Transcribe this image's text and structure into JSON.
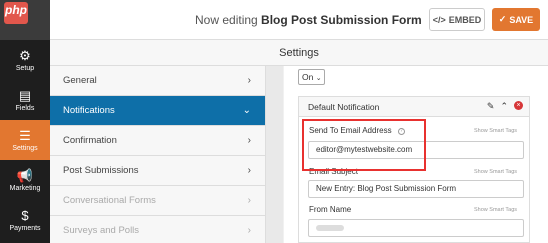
{
  "logo": {
    "text": "php"
  },
  "header": {
    "title_prefix": "Now editing",
    "form_name": "Blog Post Submission Form",
    "embed_label": "EMBED",
    "embed_icon": "code-icon",
    "save_label": "SAVE",
    "save_icon": "check-icon"
  },
  "leftnav": {
    "items": [
      {
        "label": "Setup",
        "icon": "gear-icon"
      },
      {
        "label": "Fields",
        "icon": "fields-icon"
      },
      {
        "label": "Settings",
        "icon": "sliders-icon",
        "active": true
      },
      {
        "label": "Marketing",
        "icon": "megaphone-icon"
      },
      {
        "label": "Payments",
        "icon": "dollar-icon"
      }
    ]
  },
  "settings_title": "Settings",
  "sections": [
    {
      "label": "General",
      "chevron": "›"
    },
    {
      "label": "Notifications",
      "chevron": "⌄",
      "active": true
    },
    {
      "label": "Confirmation",
      "chevron": "›"
    },
    {
      "label": "Post Submissions",
      "chevron": "›"
    },
    {
      "label": "Conversational Forms",
      "chevron": "›",
      "disabled": true
    },
    {
      "label": "Surveys and Polls",
      "chevron": "›",
      "disabled": true
    }
  ],
  "notifications": {
    "toggle_value": "On",
    "panel_title": "Default Notification",
    "send_to_label": "Send To Email Address",
    "send_to_value": "editor@mytestwebsite.com",
    "subject_label": "Email Subject",
    "subject_value": "New Entry: Blog Post Submission Form",
    "from_label": "From Name",
    "smart_tags": "Show Smart Tags"
  },
  "colors": {
    "accent": "#e27730",
    "active_section": "#0e6fa8",
    "highlight": "#e8312f"
  }
}
